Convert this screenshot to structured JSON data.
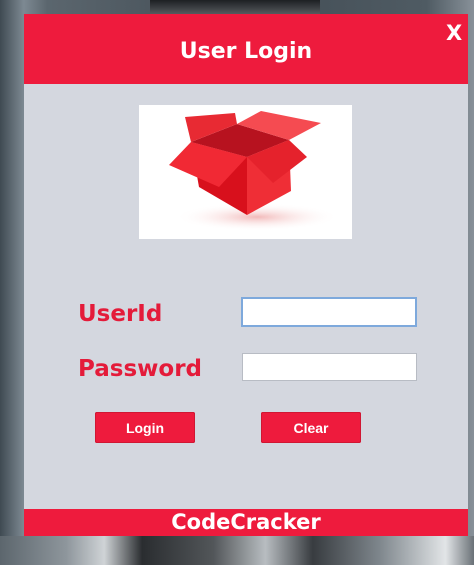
{
  "window": {
    "title": "User Login",
    "close_label": "X",
    "logo_icon": "open-red-box"
  },
  "form": {
    "userid_label": "UserId",
    "password_label": "Password",
    "userid_value": "",
    "password_value": ""
  },
  "buttons": {
    "login_label": "Login",
    "clear_label": "Clear"
  },
  "footer": {
    "text": "CodeCracker"
  },
  "colors": {
    "accent": "#ee1b3d",
    "label": "#e41b3a",
    "panel": "#d4d7df"
  }
}
